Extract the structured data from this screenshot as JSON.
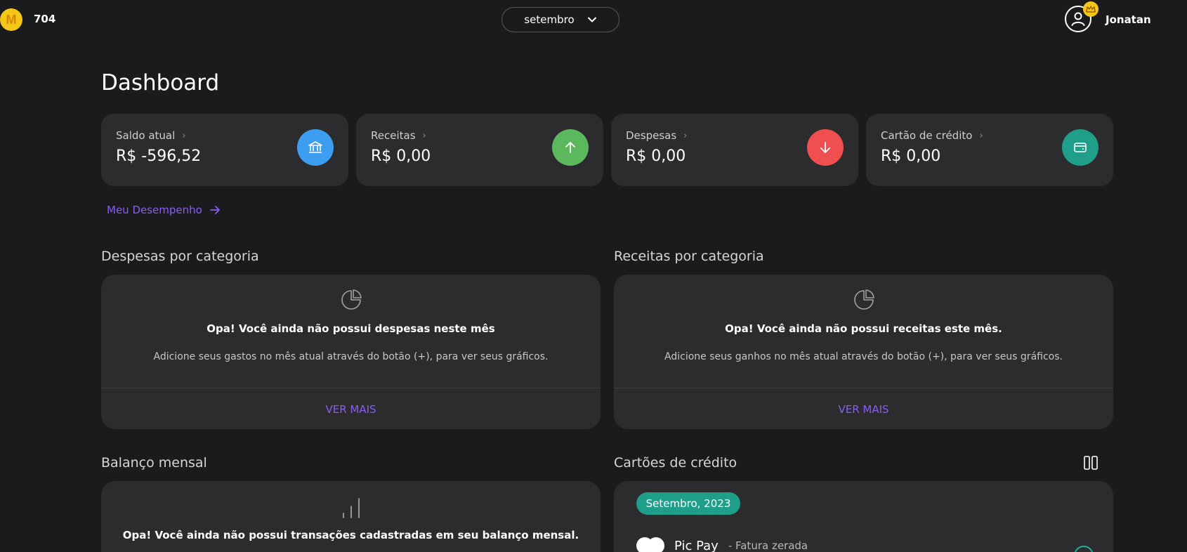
{
  "header": {
    "points": "704",
    "month": "setembro",
    "user_name": "Jonatan",
    "logo_letter": "M"
  },
  "page": {
    "title": "Dashboard"
  },
  "cards": [
    {
      "label": "Saldo atual",
      "value": "R$ -596,52",
      "icon": "bank-icon",
      "color": "#3d9df0"
    },
    {
      "label": "Receitas",
      "value": "R$ 0,00",
      "icon": "arrow-up-icon",
      "color": "#5cb85c"
    },
    {
      "label": "Despesas",
      "value": "R$ 0,00",
      "icon": "arrow-down-icon",
      "color": "#ef4f4f"
    },
    {
      "label": "Cartão de crédito",
      "value": "R$ 0,00",
      "icon": "wallet-icon",
      "color": "#1f9e8a"
    }
  ],
  "performance_link": "Meu Desempenho",
  "expenses_by_category": {
    "title": "Despesas por categoria",
    "empty_title": "Opa! Você ainda não possui despesas neste mês",
    "empty_desc": "Adicione seus gastos no mês atual através do botão (+), para ver seus gráficos.",
    "see_more": "VER MAIS"
  },
  "income_by_category": {
    "title": "Receitas por categoria",
    "empty_title": "Opa! Você ainda não possui receitas este mês.",
    "empty_desc": "Adicione seus ganhos no mês atual através do botão (+), para ver seus gráficos.",
    "see_more": "VER MAIS"
  },
  "monthly_balance": {
    "title": "Balanço mensal",
    "empty_title": "Opa! Você ainda não possui transações cadastradas em seu balanço mensal."
  },
  "credit_cards": {
    "title": "Cartões de crédito",
    "period": "Setembro, 2023",
    "items": [
      {
        "name": "Pic Pay",
        "status": " - Fatura zerada"
      }
    ]
  },
  "colors": {
    "background": "#1b1b1d",
    "panel": "#2c2c2f",
    "accent_purple": "#8a5cf6",
    "teal": "#1f9e8a",
    "gold": "#f5c518"
  }
}
